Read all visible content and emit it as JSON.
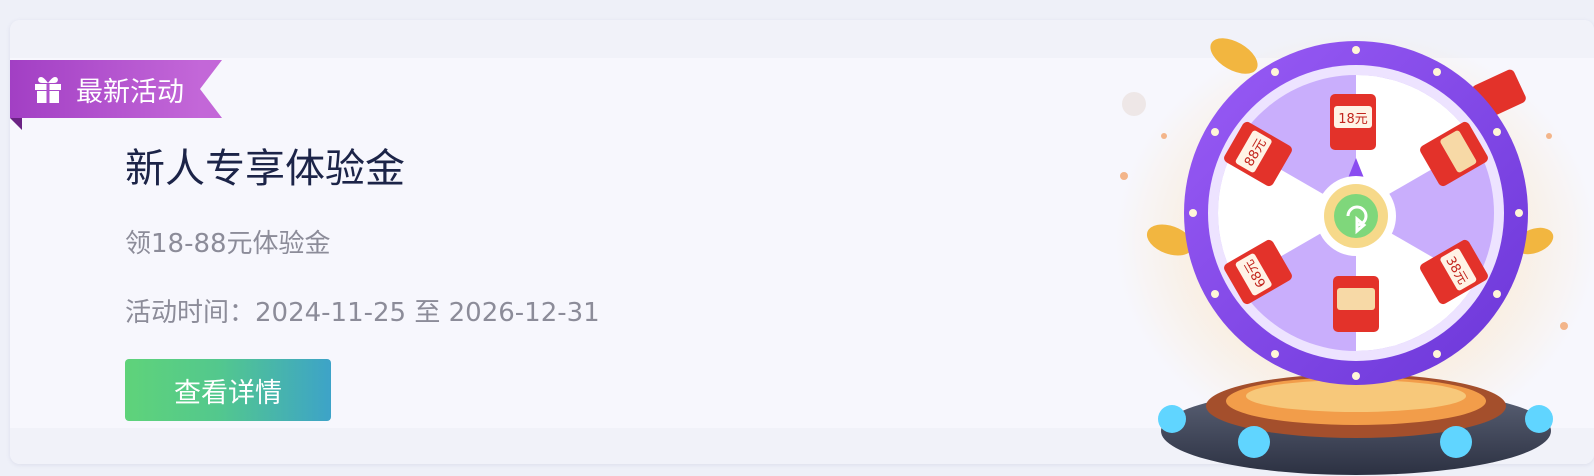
{
  "banner": {
    "ribbon_label": "最新活动",
    "title": "新人专享体验金",
    "subtitle": "领18-88元体验金",
    "period": "活动时间：2024-11-25 至 2026-12-31",
    "button_label": "查看详情"
  },
  "wheel": {
    "prizes": [
      "18元",
      "38元",
      "88元",
      "68元"
    ]
  },
  "colors": {
    "ribbon": "#b04fce",
    "title": "#1c2448",
    "muted_text": "#8c8c99",
    "button_start": "#5fd37a",
    "button_end": "#3da3c8",
    "wheel_purple": "#8a4cf0"
  }
}
